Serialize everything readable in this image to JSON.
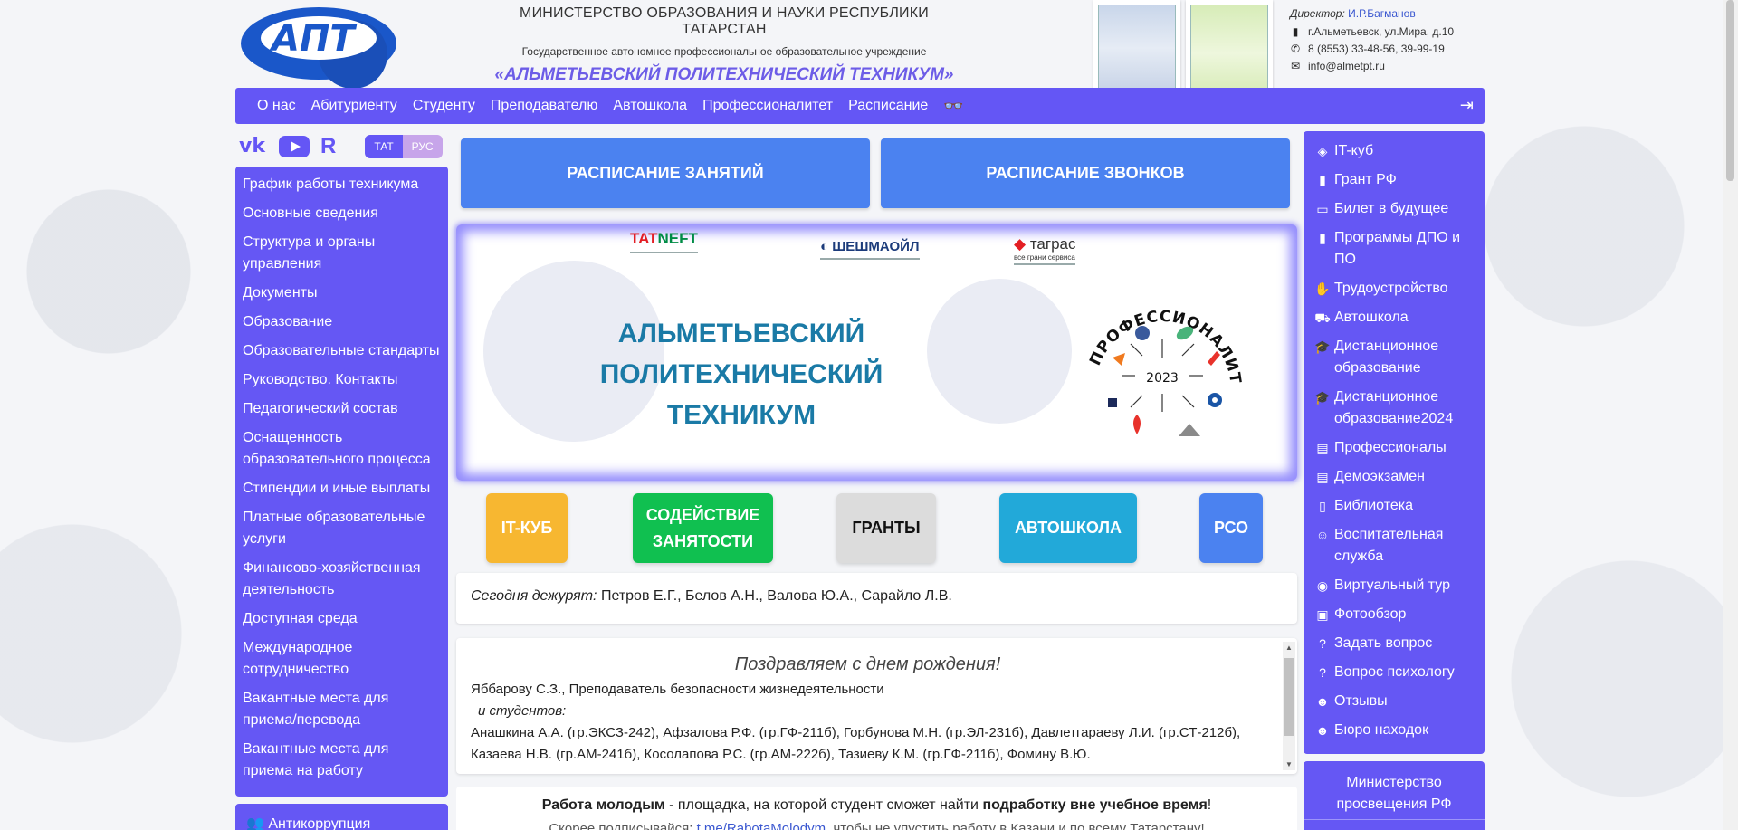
{
  "header": {
    "ministry": "МИНИСТЕРСТВО ОБРАЗОВАНИЯ И НАУКИ РЕСПУБЛИКИ ТАТАРСТАН",
    "gov": "Государственное автономное профессиональное образовательное учреждение",
    "name": "«АЛЬМЕТЬЕВСКИЙ ПОЛИТЕХНИЧЕСКИЙ ТЕХНИКУМ»",
    "logo_text": "АПТ"
  },
  "contacts": {
    "director_label": "Директор:",
    "director_name": "И.Р.Багманов",
    "address": "г.Альметьевск, ул.Мира, д.10",
    "phone": "8 (8553) 33-48-56, 39-99-19",
    "email": "info@almetpt.ru"
  },
  "topnav": {
    "items": [
      "О нас",
      "Абитуриенту",
      "Студенту",
      "Преподавателю",
      "Автошкола",
      "Профессионалитет",
      "Расписание"
    ]
  },
  "social": {
    "vk": "vk",
    "rt": "R",
    "lang_tat": "ТАТ",
    "lang_rus": "РУС"
  },
  "leftmenu": {
    "items": [
      "График работы техникума",
      "Основные сведения",
      "Структура и органы управления",
      "Документы",
      "Образование",
      "Образовательные стандарты",
      "Руководство. Контакты",
      "Педагогический состав",
      "Оснащенность образовательного процесса",
      "Стипендии и иные выплаты",
      "Платные образовательные услуги",
      "Финансово-хозяйственная деятельность",
      "Доступная среда",
      "Международное сотрудничество",
      "Вакантные места для приема/перевода",
      "Вакантные места для приема на работу"
    ],
    "anticorruption": "Антикоррупция"
  },
  "schedule": {
    "classes": "РАСПИСАНИЕ ЗАНЯТИЙ",
    "bells": "РАСПИСАНИЕ ЗВОНКОВ"
  },
  "banner": {
    "tatneft_a": "TAT",
    "tatneft_b": "NEFT",
    "sheshma": "ШЕШМАОЙЛ",
    "tagras": "таграс",
    "tagras_sub": "все грани сервиса",
    "title_l1": "АЛЬМЕТЬЕВСКИЙ",
    "title_l2": "ПОЛИТЕХНИЧЕСКИЙ",
    "title_l3": "ТЕХНИКУМ",
    "prof_label": "ПРОФЕССИОНАЛИТЕТ",
    "prof_year": "2023"
  },
  "tiles": {
    "itcube": "IT-КУБ",
    "employment_l1": "СОДЕЙСТВИЕ",
    "employment_l2": "ЗАНЯТОСТИ",
    "grants": "ГРАНТЫ",
    "autoschool": "АВТОШКОЛА",
    "rso": "РСО"
  },
  "duty": {
    "label": "Сегодня дежурят:",
    "names": " Петров Е.Г., Белов А.Н., Валова Ю.А., Сарайло Л.В."
  },
  "birthday": {
    "title": "Поздравляем с днем рождения!",
    "staff": "Яббарову С.З., Преподаватель безопасности жизнедеятельности",
    "students_label": "и студентов:",
    "students_1": "Анашкина А.А. (гр.ЭКСЗ-242),   Афзалова Р.Ф. (гр.ГФ-211б),   Горбунова М.Н. (гр.ЭЛ-231б),   Давлетгараеву Л.И. (гр.СТ-212б),   Казаева Н.В. (гр.АМ-241б),   Косолапова Р.С. (гр.АМ-222б),   Тазиеву К.М. (гр.ГФ-211б),   Фомину В.Ю."
  },
  "work": {
    "bold1": "Работа молодым",
    "text": " - площадка, на которой студент сможет найти ",
    "bold2": "подработку вне учебное время",
    "end": "!",
    "sub_start": "Скорее подписывайся: ",
    "sub_link": "t.me/RabotaMolodym",
    "sub_end": ", чтобы не упустить работу в Казани и по всему Татарстану!"
  },
  "rightmenu": {
    "items": [
      {
        "icon": "cube-icon",
        "glyph": "◈",
        "label": "IT-куб"
      },
      {
        "icon": "bookmark-icon",
        "glyph": "▮",
        "label": "Грант РФ"
      },
      {
        "icon": "ticket-icon",
        "glyph": "▭",
        "label": "Билет в будущее"
      },
      {
        "icon": "bookmark-icon",
        "glyph": "▮",
        "label": "Программы ДПО и ПО"
      },
      {
        "icon": "handshake-icon",
        "glyph": "✋",
        "label": "Трудоустройство"
      },
      {
        "icon": "car-icon",
        "glyph": "⛟",
        "label": "Автошкола"
      },
      {
        "icon": "graduation-cap-icon",
        "glyph": "🎓",
        "label": "Дистанционное образование"
      },
      {
        "icon": "graduation-cap-icon",
        "glyph": "🎓",
        "label": "Дистанционное образование2024"
      },
      {
        "icon": "chalkboard-icon",
        "glyph": "▤",
        "label": "Профессионалы"
      },
      {
        "icon": "chalkboard-icon",
        "glyph": "▤",
        "label": "Демоэкзамен"
      },
      {
        "icon": "book-icon",
        "glyph": "▯",
        "label": "Библиотека"
      },
      {
        "icon": "theater-masks-icon",
        "glyph": "☺",
        "label": "Воспитательная служба"
      },
      {
        "icon": "eye-icon",
        "glyph": "◉",
        "label": "Виртуальный тур"
      },
      {
        "icon": "image-icon",
        "glyph": "▣",
        "label": "Фотообзор"
      },
      {
        "icon": "question-icon",
        "glyph": "?",
        "label": "Задать вопрос"
      },
      {
        "icon": "question-icon",
        "glyph": "?",
        "label": "Вопрос психологу"
      },
      {
        "icon": "user-check-icon",
        "glyph": "☻",
        "label": "Отзывы"
      },
      {
        "icon": "user-check-icon",
        "glyph": "☻",
        "label": "Бюро находок"
      }
    ],
    "ministry": "Министерство просвещения РФ"
  }
}
